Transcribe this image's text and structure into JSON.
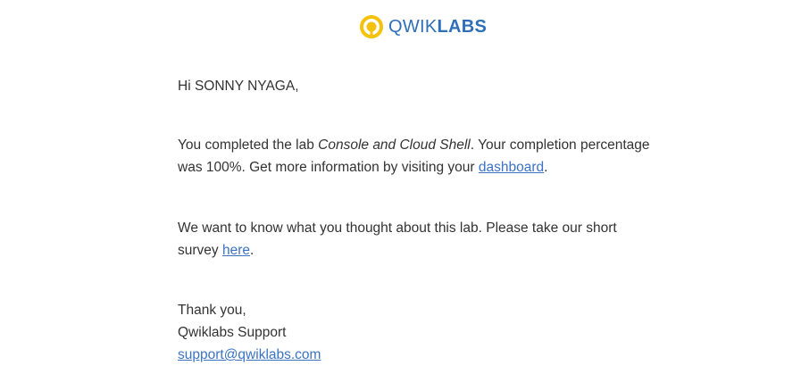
{
  "brand": {
    "logo_light": "QWIK",
    "logo_bold": "LABS",
    "colors": {
      "logo_mark_yellow": "#f4c20d",
      "logo_text_blue": "#2f6fb8",
      "link_blue": "#3b73c4",
      "body_text": "#333333"
    }
  },
  "email": {
    "greeting": "Hi SONNY NYAGA,",
    "completion": {
      "prefix": "You completed the lab ",
      "lab_name": "Console and Cloud Shell",
      "middle": ". Your completion percentage was 100%. Get more information by visiting your ",
      "link_text": "dashboard",
      "suffix": "."
    },
    "survey": {
      "prefix": "We want to know what you thought about this lab. Please take our short survey ",
      "link_text": "here",
      "suffix": "."
    },
    "signoff": {
      "thanks": "Thank you,",
      "team": "Qwiklabs Support",
      "email_link": "support@qwiklabs.com"
    }
  }
}
